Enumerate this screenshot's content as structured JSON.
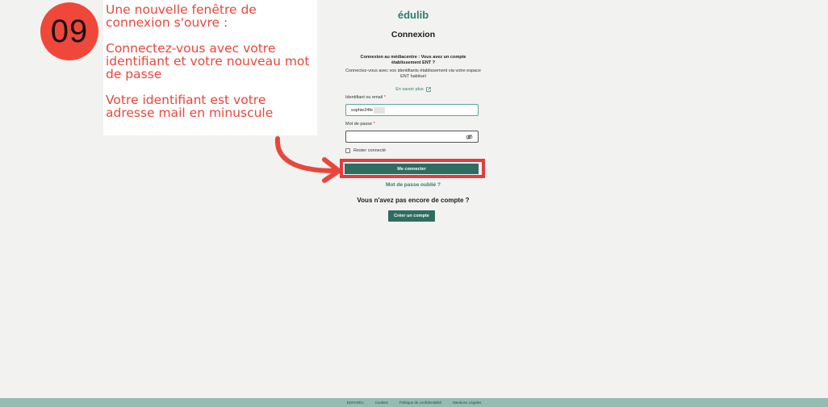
{
  "tutorial": {
    "step_number": "09",
    "lines": [
      "Une nouvelle fenêtre de connexion s'ouvre :",
      "Connectez-vous avec votre identifiant et votre nouveau mot de passe",
      "Votre identifiant est votre adresse mail en minuscule"
    ],
    "accent_color": "#f0473b"
  },
  "login": {
    "logo": "édulib",
    "title": "Connexion",
    "ent_heading": "Connexion au médiacentre : Vous avez un compte établissement ENT ?",
    "ent_description": "Connectez-vous avec vos identifiants établissement via votre espace ENT habituel",
    "learn_more": "En savoir plus",
    "identifier_label": "Identifiant ou email",
    "identifier_value": "sophie24fe",
    "password_label": "Mot de passe",
    "required_mark": "*",
    "remember_me": "Rester connecté",
    "submit": "Me connecter",
    "forgot_password": "Mot de passe oublié ?",
    "no_account": "Vous n'avez pas encore de compte ?",
    "create_account": "Créer un compte",
    "brand_color": "#2f6c62",
    "eye_icon": "eye-slash-icon",
    "external_icon": "external-link-icon"
  },
  "footer": {
    "links": [
      "EDIVISEU",
      "Cookies",
      "Politique de confidentialité",
      "Mentions Légales"
    ],
    "background": "#93bcb3"
  }
}
